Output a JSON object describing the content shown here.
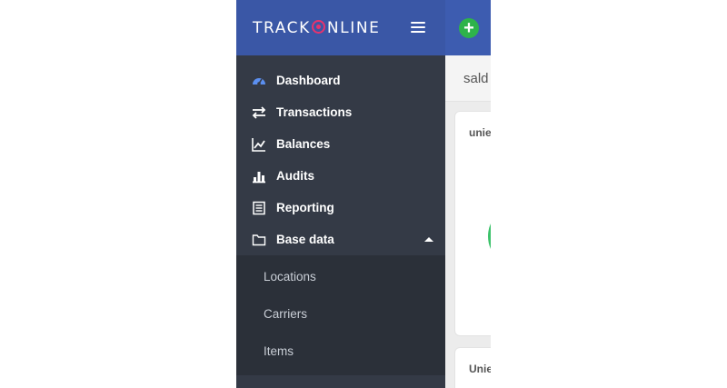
{
  "brand": {
    "logo_pre": "TRACK",
    "logo_post": "NLINE"
  },
  "sidebar": {
    "items": [
      {
        "label": "Dashboard",
        "icon": "dashboard-icon"
      },
      {
        "label": "Transactions",
        "icon": "transfer-arrows-icon"
      },
      {
        "label": "Balances",
        "icon": "line-chart-icon"
      },
      {
        "label": "Audits",
        "icon": "bar-chart-icon"
      },
      {
        "label": "Reporting",
        "icon": "report-list-icon"
      },
      {
        "label": "Base data",
        "icon": "folder-icon",
        "expanded": true
      }
    ],
    "subitems": [
      {
        "label": "Locations"
      },
      {
        "label": "Carriers"
      },
      {
        "label": "Items"
      }
    ]
  },
  "main": {
    "page_title": "sald",
    "cards": [
      {
        "title": "unie"
      },
      {
        "title": "Unie"
      }
    ]
  },
  "colors": {
    "sidebar_bg": "#343a46",
    "header_bg": "#3a57a6",
    "accent_icon": "#5b8ff0",
    "logo_o": "#e8336d",
    "add_button": "#2eb34a"
  }
}
